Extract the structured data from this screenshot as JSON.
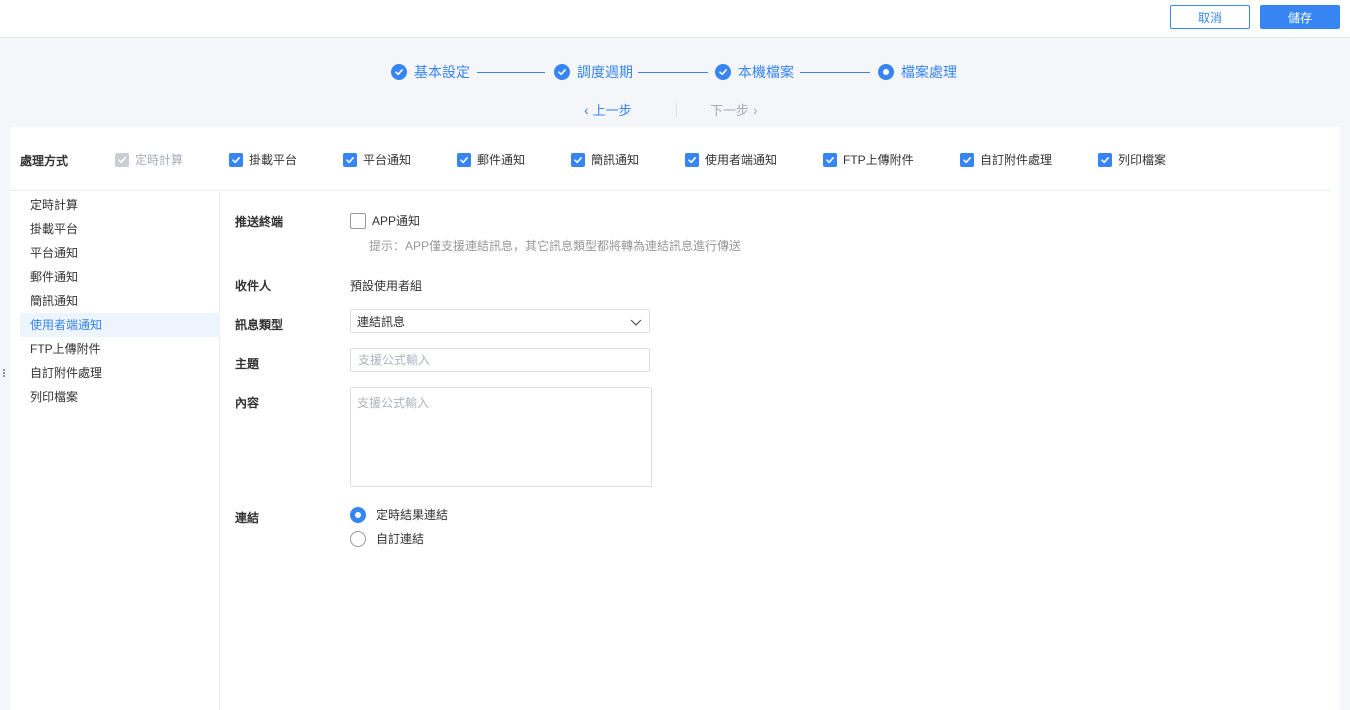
{
  "toolbar": {
    "cancel_label": "取消",
    "save_label": "儲存"
  },
  "steps": [
    {
      "label": "基本設定",
      "state": "done"
    },
    {
      "label": "調度週期",
      "state": "done"
    },
    {
      "label": "本機檔案",
      "state": "done"
    },
    {
      "label": "檔案處理",
      "state": "current"
    }
  ],
  "pager": {
    "prev_label": "上一步",
    "next_label": "下一步"
  },
  "methods": {
    "label": "處理方式",
    "options": [
      {
        "label": "定時計算",
        "checked": true,
        "disabled": true
      },
      {
        "label": "掛載平台",
        "checked": true
      },
      {
        "label": "平台通知",
        "checked": true
      },
      {
        "label": "郵件通知",
        "checked": true
      },
      {
        "label": "簡訊通知",
        "checked": true
      },
      {
        "label": "使用者端通知",
        "checked": true
      },
      {
        "label": "FTP上傳附件",
        "checked": true
      },
      {
        "label": "自訂附件處理",
        "checked": true
      },
      {
        "label": "列印檔案",
        "checked": true
      }
    ]
  },
  "sidebar": {
    "items": [
      {
        "label": "定時計算"
      },
      {
        "label": "掛載平台"
      },
      {
        "label": "平台通知"
      },
      {
        "label": "郵件通知"
      },
      {
        "label": "簡訊通知"
      },
      {
        "label": "使用者端通知",
        "active": true
      },
      {
        "label": "FTP上傳附件"
      },
      {
        "label": "自訂附件處理"
      },
      {
        "label": "列印檔案"
      }
    ]
  },
  "form": {
    "push_terminal": {
      "label": "推送終端",
      "app_label": "APP通知",
      "app_checked": false,
      "hint": "提示：APP僅支援連結訊息，其它訊息類型都將轉為連結訊息進行傳送"
    },
    "recipient": {
      "label": "收件人",
      "value": "預設使用者組"
    },
    "message_type": {
      "label": "訊息類型",
      "value": "連結訊息"
    },
    "subject": {
      "label": "主題",
      "placeholder": "支援公式輸入"
    },
    "content": {
      "label": "內容",
      "placeholder": "支援公式輸入"
    },
    "link": {
      "label": "連結",
      "options": [
        {
          "label": "定時結果連結",
          "checked": true
        },
        {
          "label": "自訂連結",
          "checked": false
        }
      ]
    }
  },
  "colors": {
    "accent": "#3685f2",
    "disabled": "#c9cdd4",
    "border": "#dcdfe6"
  }
}
